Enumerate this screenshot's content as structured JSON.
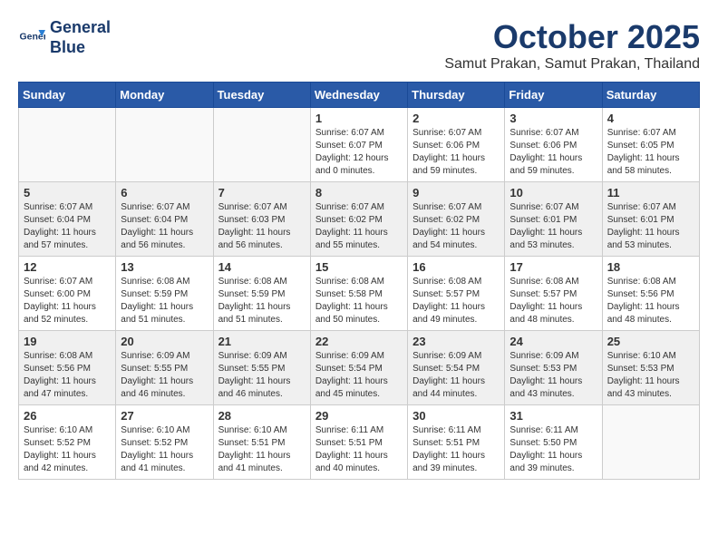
{
  "logo": {
    "line1": "General",
    "line2": "Blue"
  },
  "title": "October 2025",
  "location": "Samut Prakan, Samut Prakan, Thailand",
  "weekdays": [
    "Sunday",
    "Monday",
    "Tuesday",
    "Wednesday",
    "Thursday",
    "Friday",
    "Saturday"
  ],
  "weeks": [
    [
      {
        "day": "",
        "info": ""
      },
      {
        "day": "",
        "info": ""
      },
      {
        "day": "",
        "info": ""
      },
      {
        "day": "1",
        "info": "Sunrise: 6:07 AM\nSunset: 6:07 PM\nDaylight: 12 hours\nand 0 minutes."
      },
      {
        "day": "2",
        "info": "Sunrise: 6:07 AM\nSunset: 6:06 PM\nDaylight: 11 hours\nand 59 minutes."
      },
      {
        "day": "3",
        "info": "Sunrise: 6:07 AM\nSunset: 6:06 PM\nDaylight: 11 hours\nand 59 minutes."
      },
      {
        "day": "4",
        "info": "Sunrise: 6:07 AM\nSunset: 6:05 PM\nDaylight: 11 hours\nand 58 minutes."
      }
    ],
    [
      {
        "day": "5",
        "info": "Sunrise: 6:07 AM\nSunset: 6:04 PM\nDaylight: 11 hours\nand 57 minutes."
      },
      {
        "day": "6",
        "info": "Sunrise: 6:07 AM\nSunset: 6:04 PM\nDaylight: 11 hours\nand 56 minutes."
      },
      {
        "day": "7",
        "info": "Sunrise: 6:07 AM\nSunset: 6:03 PM\nDaylight: 11 hours\nand 56 minutes."
      },
      {
        "day": "8",
        "info": "Sunrise: 6:07 AM\nSunset: 6:02 PM\nDaylight: 11 hours\nand 55 minutes."
      },
      {
        "day": "9",
        "info": "Sunrise: 6:07 AM\nSunset: 6:02 PM\nDaylight: 11 hours\nand 54 minutes."
      },
      {
        "day": "10",
        "info": "Sunrise: 6:07 AM\nSunset: 6:01 PM\nDaylight: 11 hours\nand 53 minutes."
      },
      {
        "day": "11",
        "info": "Sunrise: 6:07 AM\nSunset: 6:01 PM\nDaylight: 11 hours\nand 53 minutes."
      }
    ],
    [
      {
        "day": "12",
        "info": "Sunrise: 6:07 AM\nSunset: 6:00 PM\nDaylight: 11 hours\nand 52 minutes."
      },
      {
        "day": "13",
        "info": "Sunrise: 6:08 AM\nSunset: 5:59 PM\nDaylight: 11 hours\nand 51 minutes."
      },
      {
        "day": "14",
        "info": "Sunrise: 6:08 AM\nSunset: 5:59 PM\nDaylight: 11 hours\nand 51 minutes."
      },
      {
        "day": "15",
        "info": "Sunrise: 6:08 AM\nSunset: 5:58 PM\nDaylight: 11 hours\nand 50 minutes."
      },
      {
        "day": "16",
        "info": "Sunrise: 6:08 AM\nSunset: 5:57 PM\nDaylight: 11 hours\nand 49 minutes."
      },
      {
        "day": "17",
        "info": "Sunrise: 6:08 AM\nSunset: 5:57 PM\nDaylight: 11 hours\nand 48 minutes."
      },
      {
        "day": "18",
        "info": "Sunrise: 6:08 AM\nSunset: 5:56 PM\nDaylight: 11 hours\nand 48 minutes."
      }
    ],
    [
      {
        "day": "19",
        "info": "Sunrise: 6:08 AM\nSunset: 5:56 PM\nDaylight: 11 hours\nand 47 minutes."
      },
      {
        "day": "20",
        "info": "Sunrise: 6:09 AM\nSunset: 5:55 PM\nDaylight: 11 hours\nand 46 minutes."
      },
      {
        "day": "21",
        "info": "Sunrise: 6:09 AM\nSunset: 5:55 PM\nDaylight: 11 hours\nand 46 minutes."
      },
      {
        "day": "22",
        "info": "Sunrise: 6:09 AM\nSunset: 5:54 PM\nDaylight: 11 hours\nand 45 minutes."
      },
      {
        "day": "23",
        "info": "Sunrise: 6:09 AM\nSunset: 5:54 PM\nDaylight: 11 hours\nand 44 minutes."
      },
      {
        "day": "24",
        "info": "Sunrise: 6:09 AM\nSunset: 5:53 PM\nDaylight: 11 hours\nand 43 minutes."
      },
      {
        "day": "25",
        "info": "Sunrise: 6:10 AM\nSunset: 5:53 PM\nDaylight: 11 hours\nand 43 minutes."
      }
    ],
    [
      {
        "day": "26",
        "info": "Sunrise: 6:10 AM\nSunset: 5:52 PM\nDaylight: 11 hours\nand 42 minutes."
      },
      {
        "day": "27",
        "info": "Sunrise: 6:10 AM\nSunset: 5:52 PM\nDaylight: 11 hours\nand 41 minutes."
      },
      {
        "day": "28",
        "info": "Sunrise: 6:10 AM\nSunset: 5:51 PM\nDaylight: 11 hours\nand 41 minutes."
      },
      {
        "day": "29",
        "info": "Sunrise: 6:11 AM\nSunset: 5:51 PM\nDaylight: 11 hours\nand 40 minutes."
      },
      {
        "day": "30",
        "info": "Sunrise: 6:11 AM\nSunset: 5:51 PM\nDaylight: 11 hours\nand 39 minutes."
      },
      {
        "day": "31",
        "info": "Sunrise: 6:11 AM\nSunset: 5:50 PM\nDaylight: 11 hours\nand 39 minutes."
      },
      {
        "day": "",
        "info": ""
      }
    ]
  ]
}
